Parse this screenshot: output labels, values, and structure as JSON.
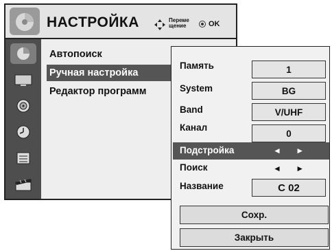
{
  "main_menu": {
    "title": "НАСТРОЙКА",
    "nav_hint": {
      "move_label": "Переме щение",
      "ok_label": "OK"
    },
    "items": [
      {
        "label": "Автопоиск",
        "selected": false
      },
      {
        "label": "Ручная настройка",
        "selected": true
      },
      {
        "label": "Редактор программ",
        "selected": false
      }
    ],
    "side_icons": [
      "setup-icon",
      "picture-icon",
      "audio-icon",
      "time-icon",
      "option-icon",
      "lock-icon"
    ]
  },
  "manual_tuning": {
    "rows": [
      {
        "label": "Память",
        "value": "1"
      },
      {
        "label": "System",
        "value": "BG"
      },
      {
        "label": "Band",
        "value": "V/UHF"
      },
      {
        "label": "Канал",
        "value": "0"
      },
      {
        "label": "Подстройка",
        "value": "◄ ►"
      },
      {
        "label": "Поиск",
        "value": "◄ ►"
      },
      {
        "label": "Название",
        "value": "C 02"
      }
    ],
    "save_label": "Сохр.",
    "close_label": "Закрыть"
  },
  "colors": {
    "selection": "#555555",
    "panel": "#f1f1f1",
    "strip": "#4e4e4e"
  }
}
